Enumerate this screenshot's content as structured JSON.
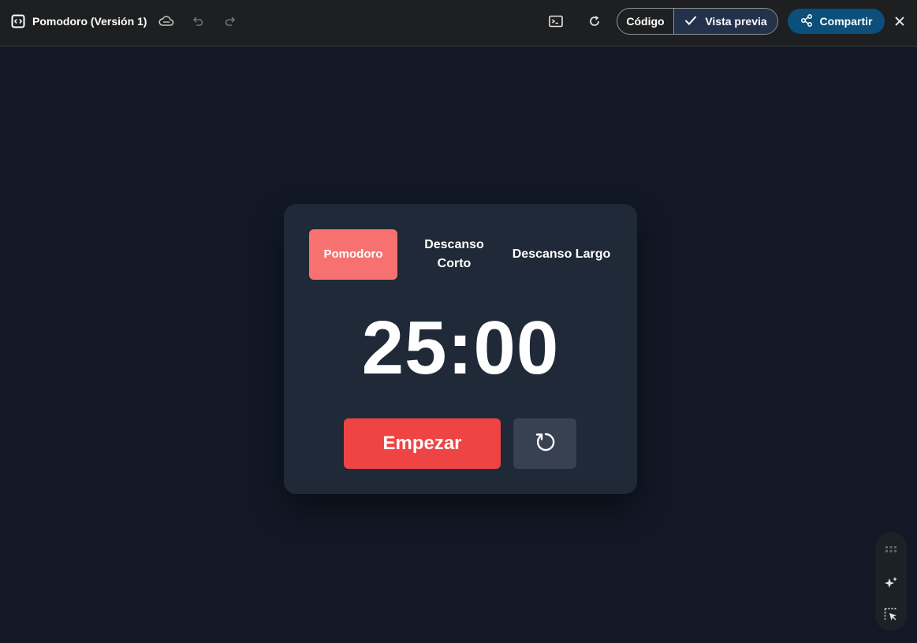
{
  "header": {
    "title": "Pomodoro (Versión 1)",
    "code_label": "Código",
    "preview_label": "Vista previa",
    "share_label": "Compartir",
    "icons": [
      "app-code-icon",
      "cloud-icon",
      "undo-icon",
      "redo-icon",
      "terminal-icon",
      "refresh-icon",
      "check-icon",
      "share-icon",
      "close-icon"
    ]
  },
  "timer_card": {
    "tabs": [
      {
        "label": "Pomodoro",
        "active": true
      },
      {
        "label": "Descanso Corto",
        "active": false
      },
      {
        "label": "Descanso Largo",
        "active": false
      }
    ],
    "time": "25:00",
    "start_label": "Empezar",
    "reset_icon": "reset-icon"
  },
  "floating_toolbar": {
    "icons": [
      "drag-grid-icon",
      "sparkle-icon",
      "select-element-icon"
    ]
  },
  "colors": {
    "background": "#121826",
    "card": "#1f2937",
    "active_tab": "#f87171",
    "start_button": "#ef4444",
    "reset_button": "#374151",
    "share_button": "#0b4f7a",
    "preview_segment": "#23324a"
  }
}
